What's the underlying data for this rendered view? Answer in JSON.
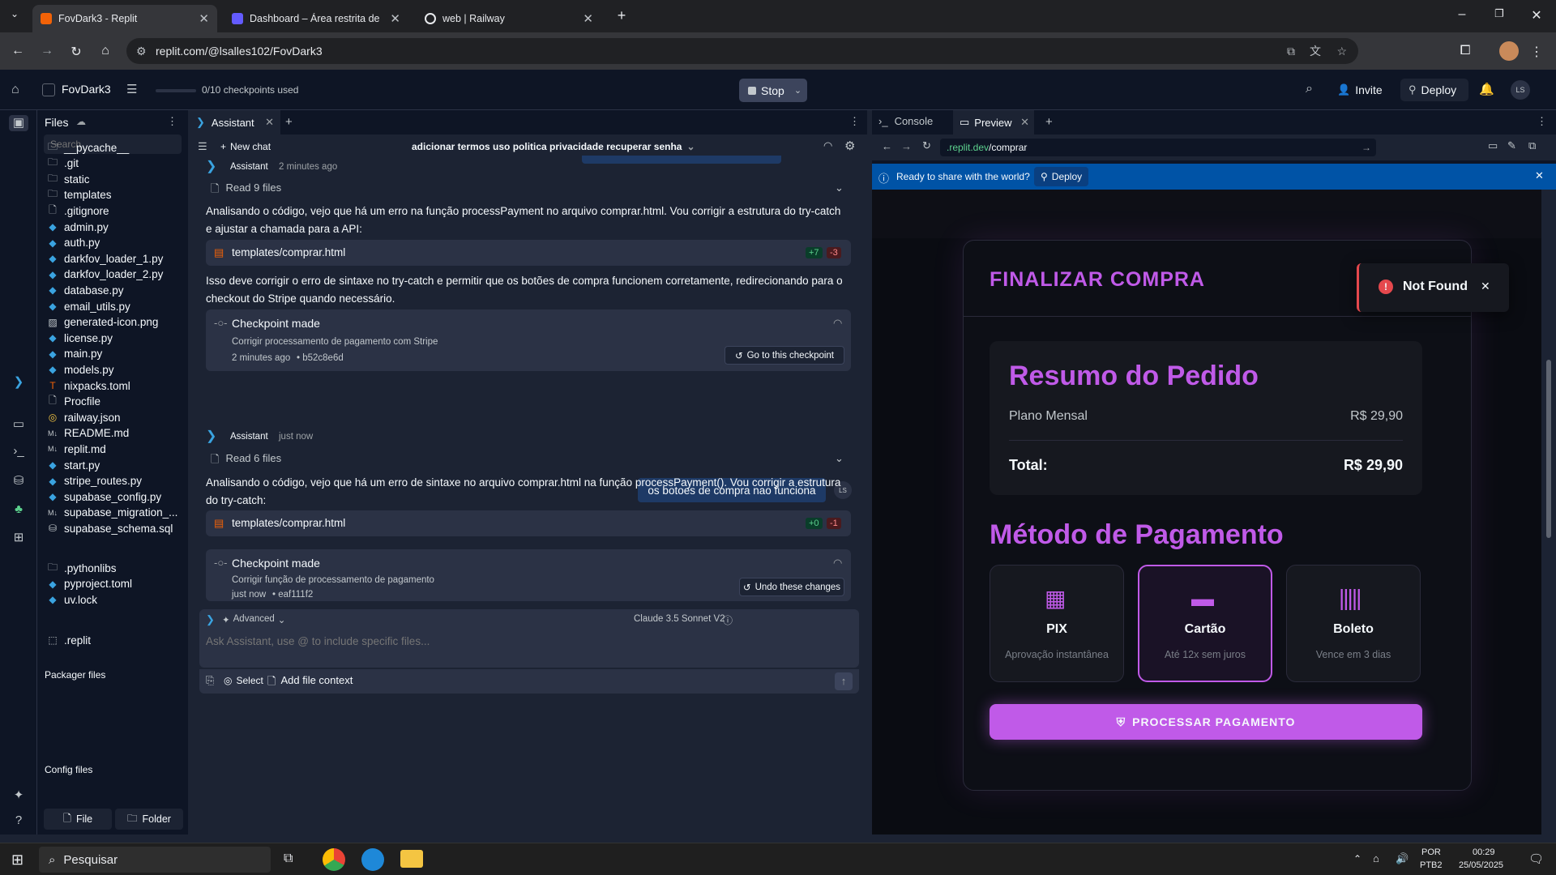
{
  "browser": {
    "tabs": [
      {
        "title": "FovDark3 - Replit",
        "active": true,
        "fav": "#f26207"
      },
      {
        "title": "Dashboard – Área restrita de Fo",
        "active": false,
        "fav": "#635bff"
      },
      {
        "title": "web | Railway",
        "active": false,
        "fav": "#e8eaed"
      }
    ],
    "url": "replit.com/@lsalles102/FovDark3"
  },
  "replit": {
    "project": "FovDark3",
    "checkpoints": "0/10 checkpoints used",
    "stop": "Stop",
    "invite": "Invite",
    "deploy": "Deploy",
    "avatar": "LS"
  },
  "files": {
    "title": "Files",
    "search_placeholder": "Search",
    "items": [
      {
        "name": "__pycache__",
        "icon": "folder-icon"
      },
      {
        "name": ".git",
        "icon": "folder-icon"
      },
      {
        "name": "static",
        "icon": "folder-icon"
      },
      {
        "name": "templates",
        "icon": "folder-icon"
      },
      {
        "name": ".gitignore",
        "icon": "file-icon"
      },
      {
        "name": "admin.py",
        "icon": "python-icon"
      },
      {
        "name": "auth.py",
        "icon": "python-icon"
      },
      {
        "name": "darkfov_loader_1.py",
        "icon": "python-icon"
      },
      {
        "name": "darkfov_loader_2.py",
        "icon": "python-icon"
      },
      {
        "name": "database.py",
        "icon": "python-icon"
      },
      {
        "name": "email_utils.py",
        "icon": "python-icon"
      },
      {
        "name": "generated-icon.png",
        "icon": "image-icon"
      },
      {
        "name": "license.py",
        "icon": "python-icon"
      },
      {
        "name": "main.py",
        "icon": "python-icon"
      },
      {
        "name": "models.py",
        "icon": "python-icon"
      },
      {
        "name": "nixpacks.toml",
        "icon": "toml-icon"
      },
      {
        "name": "Procfile",
        "icon": "file-icon"
      },
      {
        "name": "railway.json",
        "icon": "json-icon"
      },
      {
        "name": "README.md",
        "icon": "markdown-icon"
      },
      {
        "name": "replit.md",
        "icon": "markdown-icon"
      },
      {
        "name": "start.py",
        "icon": "python-icon"
      },
      {
        "name": "stripe_routes.py",
        "icon": "python-icon"
      },
      {
        "name": "supabase_config.py",
        "icon": "python-icon"
      },
      {
        "name": "supabase_migration_...",
        "icon": "markdown-icon"
      },
      {
        "name": "supabase_schema.sql",
        "icon": "database-icon"
      }
    ],
    "packager_title": "Packager files",
    "packager": [
      {
        "name": ".pythonlibs",
        "icon": "folder-icon"
      },
      {
        "name": "pyproject.toml",
        "icon": "python-icon"
      },
      {
        "name": "uv.lock",
        "icon": "python-icon"
      }
    ],
    "config_title": "Config files",
    "config": [
      {
        "name": ".replit",
        "icon": "replit-icon"
      }
    ],
    "new_file": "File",
    "new_folder": "Folder"
  },
  "assistant": {
    "tab": "Assistant",
    "new_chat": "New chat",
    "chat_title": "adicionar termos uso politica privacidade recuperar senha",
    "msg1": {
      "author": "Assistant",
      "time": "2 minutes ago",
      "read": "Read 9 files",
      "text1": "Analisando o código, vejo que há um erro na função processPayment no arquivo comprar.html. Vou corrigir a estrutura do try-catch e ajustar a chamada para a API:",
      "file": "templates/comprar.html",
      "add": "+7",
      "del": "-3",
      "text2": "Isso deve corrigir o erro de sintaxe no try-catch e permitir que os botões de compra funcionem corretamente, redirecionando para o checkout do Stripe quando necessário.",
      "cp_title": "Checkpoint made",
      "cp_desc": "Corrigir processamento de pagamento com Stripe",
      "cp_time": "2 minutes ago",
      "cp_hash": "• b52c8e6d",
      "cp_btn": "Go to this checkpoint"
    },
    "user_msg": "os botoes de compra nao funciona",
    "user_avatar": "LS",
    "msg2": {
      "author": "Assistant",
      "time": "just now",
      "read": "Read 6 files",
      "text1": "Analisando o código, vejo que há um erro de sintaxe no arquivo comprar.html na função processPayment(). Vou corrigir a estrutura do try-catch:",
      "file": "templates/comprar.html",
      "add": "+0",
      "del": "-1",
      "cp_title": "Checkpoint made",
      "cp_desc": "Corrigir função de processamento de pagamento",
      "cp_time": "just now",
      "cp_hash": "• eaf111f2",
      "cp_btn": "Undo these changes"
    },
    "advanced": "Advanced",
    "model": "Claude 3.5 Sonnet V2",
    "input_placeholder": "Ask Assistant, use @ to include specific files...",
    "select": "Select",
    "add_context": "Add file context"
  },
  "preview": {
    "tab_console": "Console",
    "tab_preview": "Preview",
    "url_host": ".replit.dev",
    "url_path": "/comprar",
    "banner": "Ready to share with the world?",
    "banner_btn": "Deploy",
    "modal_title": "FINALIZAR COMPRA",
    "toast": "Not Found",
    "summary_title": "Resumo do Pedido",
    "plan": "Plano Mensal",
    "plan_price": "R$ 29,90",
    "total_label": "Total:",
    "total_value": "R$ 29,90",
    "method_title": "Método de Pagamento",
    "methods": [
      {
        "name": "PIX",
        "desc": "Aprovação instantânea"
      },
      {
        "name": "Cartão",
        "desc": "Até 12x sem juros"
      },
      {
        "name": "Boleto",
        "desc": "Vence em 3 dias"
      }
    ],
    "process_btn": "PROCESSAR PAGAMENTO"
  },
  "taskbar": {
    "search": "Pesquisar",
    "lang1": "POR",
    "lang2": "PTB2",
    "time": "00:29",
    "date": "25/05/2025"
  },
  "colors": {
    "accent": "#c05ae8",
    "brand": "#f26207",
    "banner": "#0053a6"
  }
}
